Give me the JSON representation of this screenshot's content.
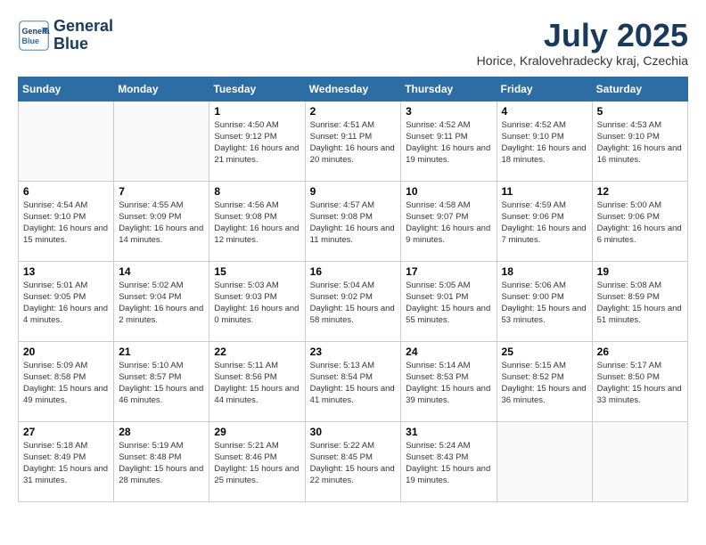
{
  "header": {
    "logo_line1": "General",
    "logo_line2": "Blue",
    "month_year": "July 2025",
    "location": "Horice, Kralovehradecky kraj, Czechia"
  },
  "weekdays": [
    "Sunday",
    "Monday",
    "Tuesday",
    "Wednesday",
    "Thursday",
    "Friday",
    "Saturday"
  ],
  "weeks": [
    [
      {
        "day": "",
        "info": ""
      },
      {
        "day": "",
        "info": ""
      },
      {
        "day": "1",
        "info": "Sunrise: 4:50 AM\nSunset: 9:12 PM\nDaylight: 16 hours and 21 minutes."
      },
      {
        "day": "2",
        "info": "Sunrise: 4:51 AM\nSunset: 9:11 PM\nDaylight: 16 hours and 20 minutes."
      },
      {
        "day": "3",
        "info": "Sunrise: 4:52 AM\nSunset: 9:11 PM\nDaylight: 16 hours and 19 minutes."
      },
      {
        "day": "4",
        "info": "Sunrise: 4:52 AM\nSunset: 9:10 PM\nDaylight: 16 hours and 18 minutes."
      },
      {
        "day": "5",
        "info": "Sunrise: 4:53 AM\nSunset: 9:10 PM\nDaylight: 16 hours and 16 minutes."
      }
    ],
    [
      {
        "day": "6",
        "info": "Sunrise: 4:54 AM\nSunset: 9:10 PM\nDaylight: 16 hours and 15 minutes."
      },
      {
        "day": "7",
        "info": "Sunrise: 4:55 AM\nSunset: 9:09 PM\nDaylight: 16 hours and 14 minutes."
      },
      {
        "day": "8",
        "info": "Sunrise: 4:56 AM\nSunset: 9:08 PM\nDaylight: 16 hours and 12 minutes."
      },
      {
        "day": "9",
        "info": "Sunrise: 4:57 AM\nSunset: 9:08 PM\nDaylight: 16 hours and 11 minutes."
      },
      {
        "day": "10",
        "info": "Sunrise: 4:58 AM\nSunset: 9:07 PM\nDaylight: 16 hours and 9 minutes."
      },
      {
        "day": "11",
        "info": "Sunrise: 4:59 AM\nSunset: 9:06 PM\nDaylight: 16 hours and 7 minutes."
      },
      {
        "day": "12",
        "info": "Sunrise: 5:00 AM\nSunset: 9:06 PM\nDaylight: 16 hours and 6 minutes."
      }
    ],
    [
      {
        "day": "13",
        "info": "Sunrise: 5:01 AM\nSunset: 9:05 PM\nDaylight: 16 hours and 4 minutes."
      },
      {
        "day": "14",
        "info": "Sunrise: 5:02 AM\nSunset: 9:04 PM\nDaylight: 16 hours and 2 minutes."
      },
      {
        "day": "15",
        "info": "Sunrise: 5:03 AM\nSunset: 9:03 PM\nDaylight: 16 hours and 0 minutes."
      },
      {
        "day": "16",
        "info": "Sunrise: 5:04 AM\nSunset: 9:02 PM\nDaylight: 15 hours and 58 minutes."
      },
      {
        "day": "17",
        "info": "Sunrise: 5:05 AM\nSunset: 9:01 PM\nDaylight: 15 hours and 55 minutes."
      },
      {
        "day": "18",
        "info": "Sunrise: 5:06 AM\nSunset: 9:00 PM\nDaylight: 15 hours and 53 minutes."
      },
      {
        "day": "19",
        "info": "Sunrise: 5:08 AM\nSunset: 8:59 PM\nDaylight: 15 hours and 51 minutes."
      }
    ],
    [
      {
        "day": "20",
        "info": "Sunrise: 5:09 AM\nSunset: 8:58 PM\nDaylight: 15 hours and 49 minutes."
      },
      {
        "day": "21",
        "info": "Sunrise: 5:10 AM\nSunset: 8:57 PM\nDaylight: 15 hours and 46 minutes."
      },
      {
        "day": "22",
        "info": "Sunrise: 5:11 AM\nSunset: 8:56 PM\nDaylight: 15 hours and 44 minutes."
      },
      {
        "day": "23",
        "info": "Sunrise: 5:13 AM\nSunset: 8:54 PM\nDaylight: 15 hours and 41 minutes."
      },
      {
        "day": "24",
        "info": "Sunrise: 5:14 AM\nSunset: 8:53 PM\nDaylight: 15 hours and 39 minutes."
      },
      {
        "day": "25",
        "info": "Sunrise: 5:15 AM\nSunset: 8:52 PM\nDaylight: 15 hours and 36 minutes."
      },
      {
        "day": "26",
        "info": "Sunrise: 5:17 AM\nSunset: 8:50 PM\nDaylight: 15 hours and 33 minutes."
      }
    ],
    [
      {
        "day": "27",
        "info": "Sunrise: 5:18 AM\nSunset: 8:49 PM\nDaylight: 15 hours and 31 minutes."
      },
      {
        "day": "28",
        "info": "Sunrise: 5:19 AM\nSunset: 8:48 PM\nDaylight: 15 hours and 28 minutes."
      },
      {
        "day": "29",
        "info": "Sunrise: 5:21 AM\nSunset: 8:46 PM\nDaylight: 15 hours and 25 minutes."
      },
      {
        "day": "30",
        "info": "Sunrise: 5:22 AM\nSunset: 8:45 PM\nDaylight: 15 hours and 22 minutes."
      },
      {
        "day": "31",
        "info": "Sunrise: 5:24 AM\nSunset: 8:43 PM\nDaylight: 15 hours and 19 minutes."
      },
      {
        "day": "",
        "info": ""
      },
      {
        "day": "",
        "info": ""
      }
    ]
  ]
}
